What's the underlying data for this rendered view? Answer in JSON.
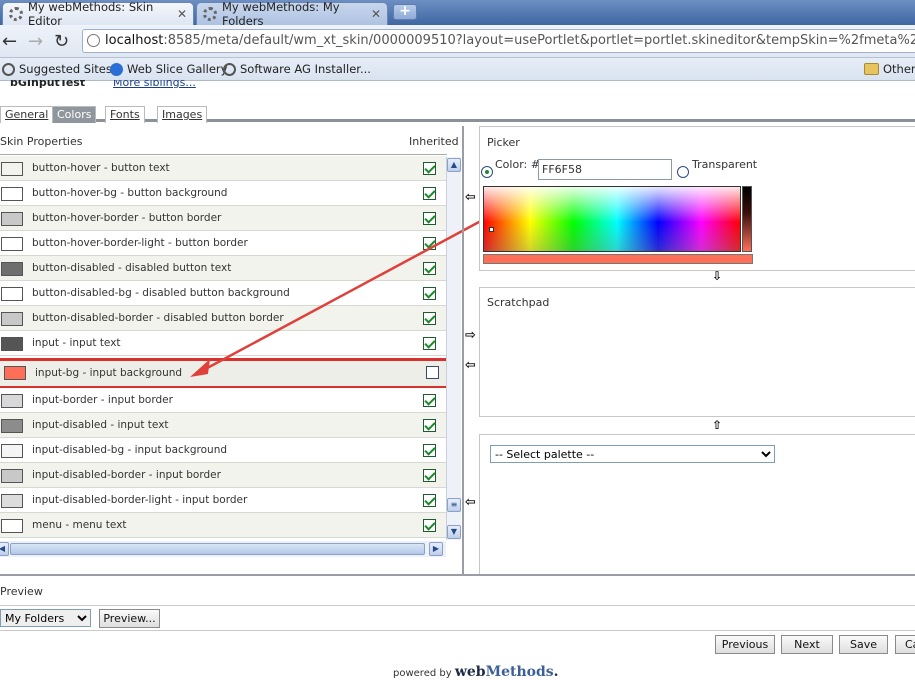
{
  "browser": {
    "tabs": [
      {
        "label": "My webMethods: Skin Editor",
        "active": true
      },
      {
        "label": "My webMethods: My Folders",
        "active": false
      }
    ],
    "url_host": "localhost",
    "url_rest": ":8585/meta/default/wm_xt_skin/0000009510?layout=usePortlet&portlet=portlet.skineditor&tempSkin=%2fmeta%2fdefault",
    "bookmarks": [
      "Suggested Sites",
      "Web Slice Gallery",
      "Software AG Installer...",
      "Other"
    ]
  },
  "header": {
    "partial_title": "bGInputTest",
    "more_siblings": "More siblings..."
  },
  "editor_tabs": [
    "General",
    "Colors",
    "Fonts",
    "Images"
  ],
  "skin_properties": {
    "heading": "Skin Properties",
    "inherited_heading": "Inherited",
    "rows": [
      {
        "label": "button-hover - button text",
        "color": "#f2f2ee",
        "inherited": true
      },
      {
        "label": "button-hover-bg - button background",
        "color": "#ffffff",
        "inherited": true
      },
      {
        "label": "button-hover-border - button border",
        "color": "#c8c8c8",
        "inherited": true
      },
      {
        "label": "button-hover-border-light - button border",
        "color": "#ffffff",
        "inherited": true
      },
      {
        "label": "button-disabled - disabled button text",
        "color": "#6e6e6e",
        "inherited": true
      },
      {
        "label": "button-disabled-bg - disabled button background",
        "color": "#ffffff",
        "inherited": true
      },
      {
        "label": "button-disabled-border - disabled button border",
        "color": "#c8c8c8",
        "inherited": true
      },
      {
        "label": "input - input text",
        "color": "#555555",
        "inherited": true
      },
      {
        "label": "input-bg - input background",
        "color": "#ff6f58",
        "inherited": false,
        "selected": true
      },
      {
        "label": "input-border - input border",
        "color": "#d8d8d8",
        "inherited": true
      },
      {
        "label": "input-disabled - input text",
        "color": "#8c8c8c",
        "inherited": true
      },
      {
        "label": "input-disabled-bg - input background",
        "color": "#f4f4f4",
        "inherited": true
      },
      {
        "label": "input-disabled-border - input border",
        "color": "#c8c8c8",
        "inherited": true
      },
      {
        "label": "input-disabled-border-light - input border",
        "color": "#dcdcdc",
        "inherited": true
      },
      {
        "label": "menu - menu text",
        "color": "#ffffff",
        "inherited": true
      }
    ]
  },
  "picker": {
    "heading": "Picker",
    "color_label": "Color: #",
    "color_value": "FF6F58",
    "transparent_label": "Transparent"
  },
  "scratchpad": {
    "heading": "Scratchpad"
  },
  "palette": {
    "selected": "-- Select palette --"
  },
  "preview": {
    "heading": "Preview",
    "selected": "My Folders",
    "button": "Preview..."
  },
  "footer_buttons": [
    "Previous",
    "Next",
    "Save",
    "Ca"
  ],
  "powered": {
    "prefix": "powered by",
    "brand_a": "web",
    "brand_b": "Methods",
    "dot": "."
  },
  "colors": {
    "accent": "#d7312c",
    "selected_color": "#ff6f58",
    "tab_active": "#8f969d"
  }
}
